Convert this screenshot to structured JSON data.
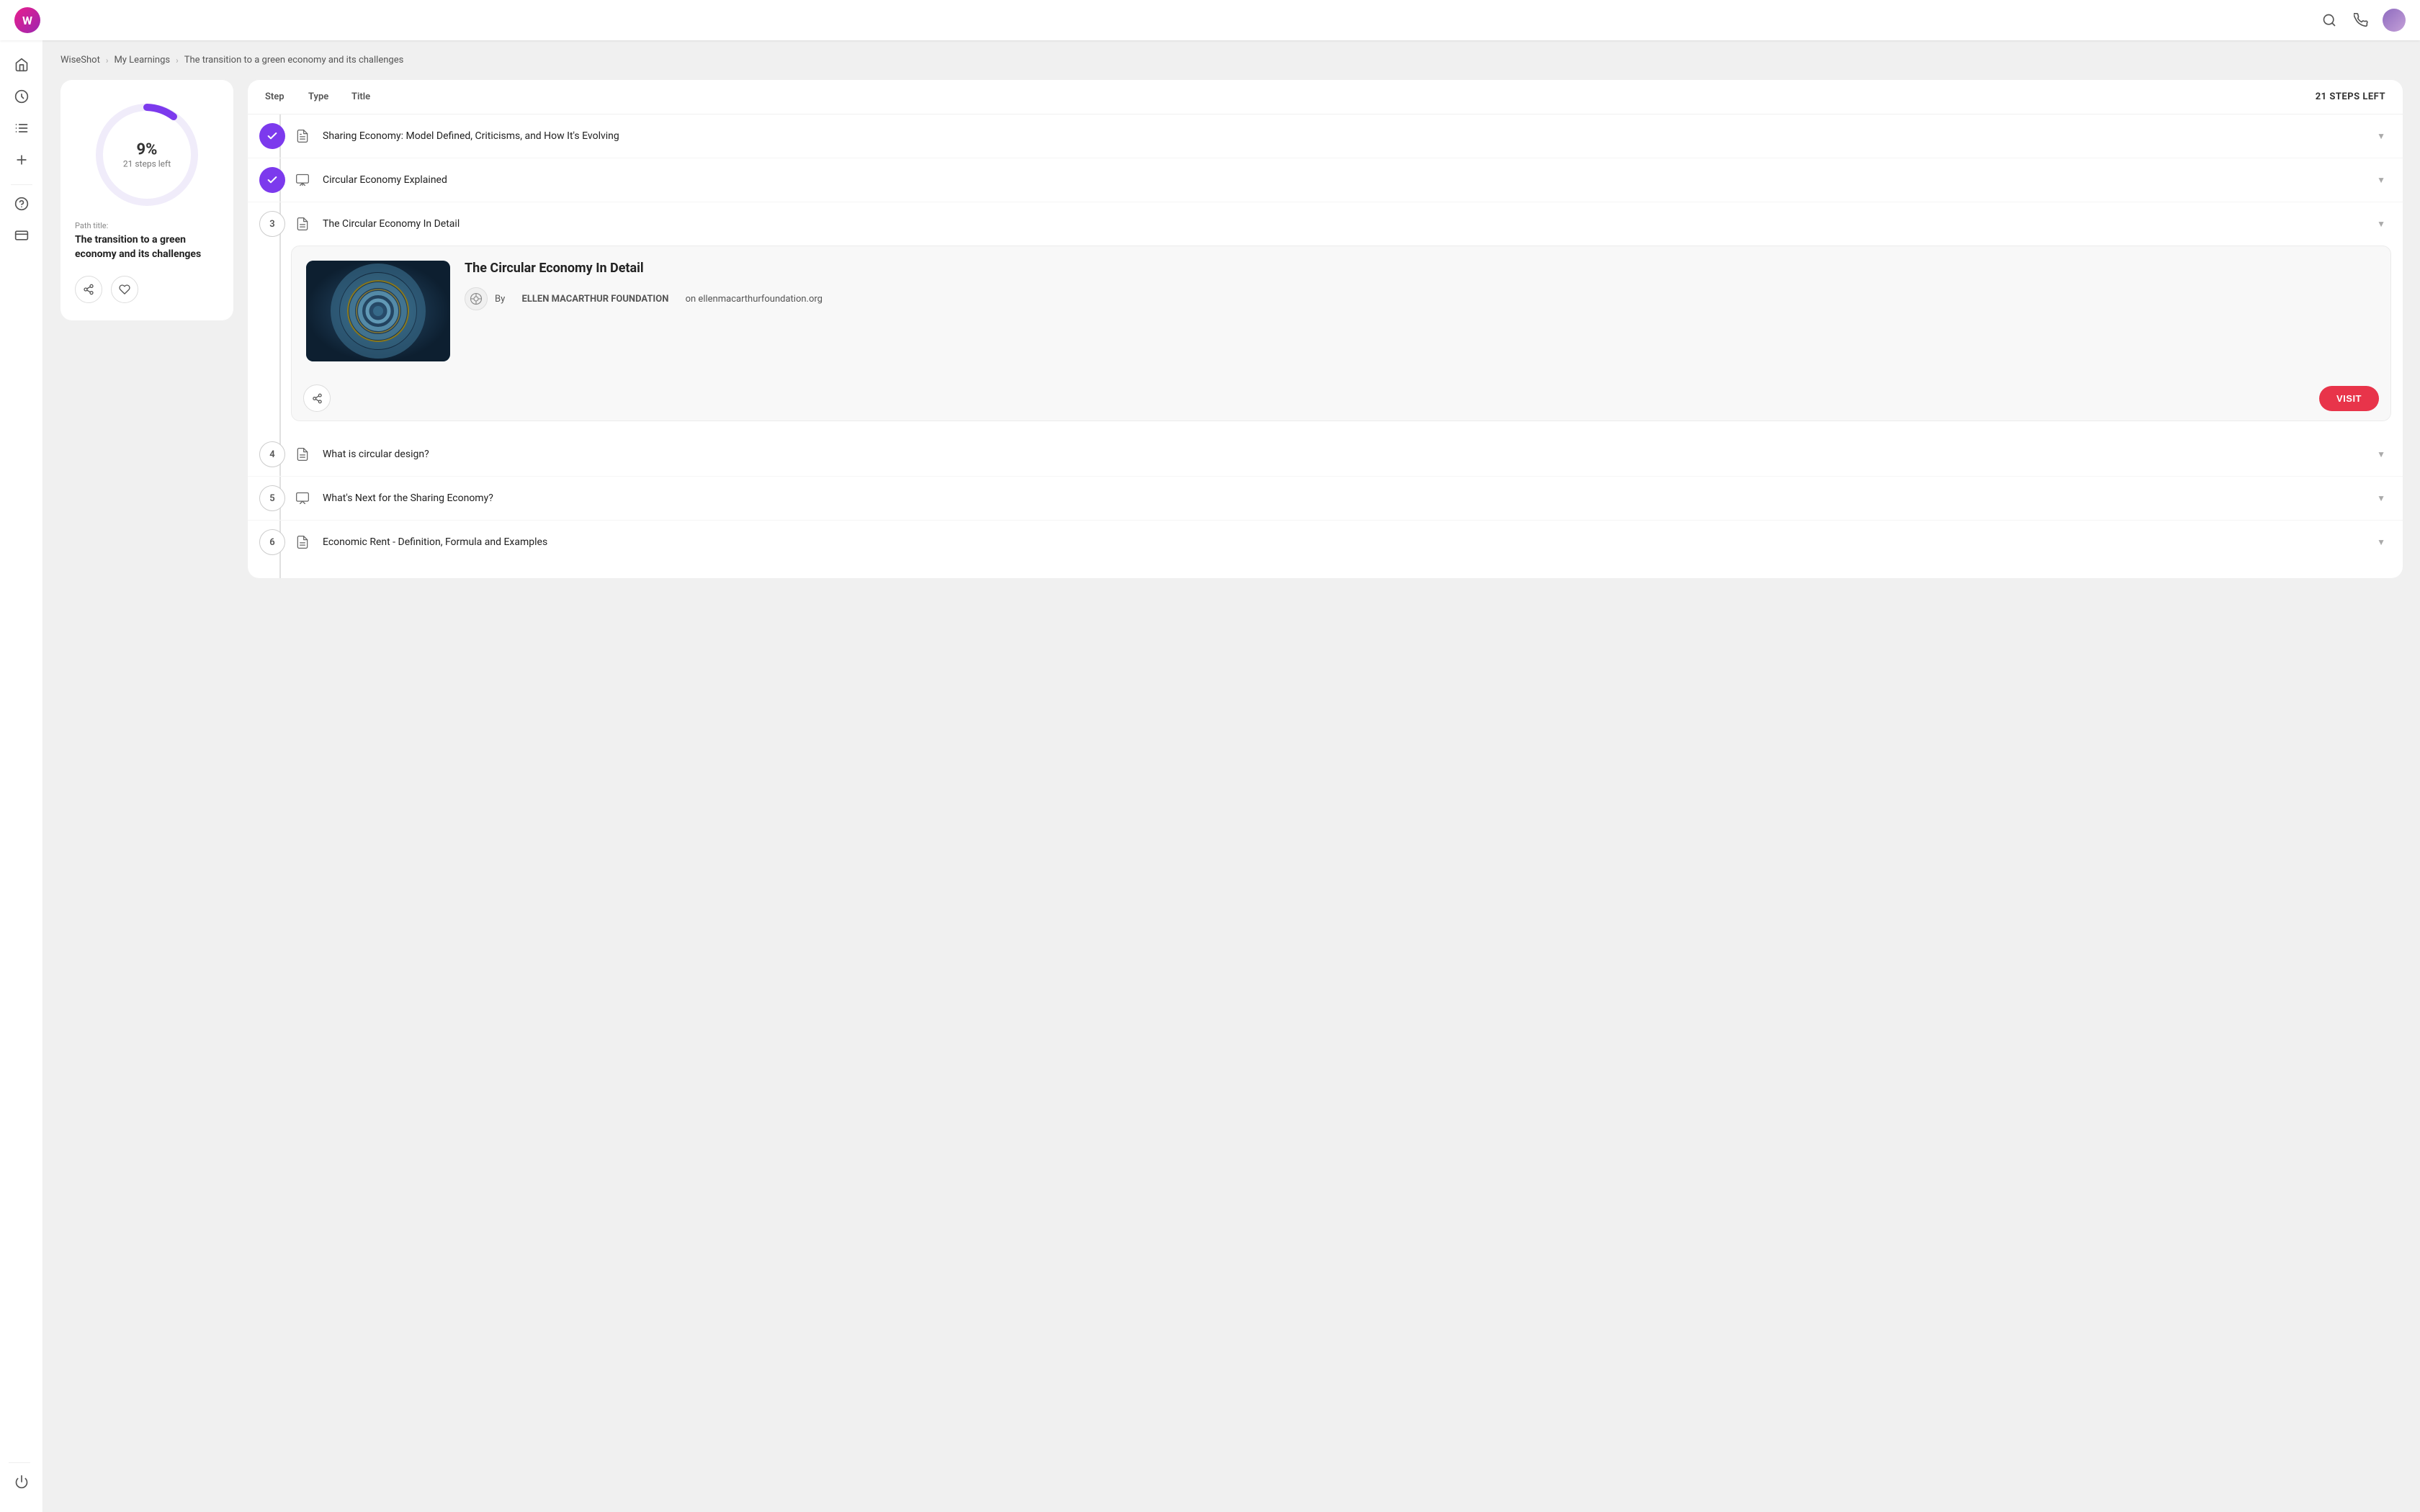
{
  "app": {
    "logo_text": "W",
    "title": "WiseShot"
  },
  "breadcrumb": {
    "items": [
      "WiseShot",
      "My Learnings",
      "The transition to a green economy and its challenges"
    ]
  },
  "sidebar": {
    "icons": [
      {
        "name": "home-icon",
        "symbol": "⌂"
      },
      {
        "name": "lightbulb-icon",
        "symbol": "💡"
      },
      {
        "name": "list-icon",
        "symbol": "☰"
      },
      {
        "name": "add-icon",
        "symbol": "+"
      },
      {
        "name": "help-icon",
        "symbol": "?"
      },
      {
        "name": "card-icon",
        "symbol": "▭"
      },
      {
        "name": "power-icon",
        "symbol": "⏻"
      }
    ]
  },
  "progress": {
    "percent": "9%",
    "steps_left_label": "21 steps left",
    "arc_color": "#7c3aed",
    "track_color": "#e8e0f5"
  },
  "path": {
    "label": "Path title:",
    "title": "The transition to a green economy and its challenges"
  },
  "steps_header": {
    "step_col": "Step",
    "type_col": "Type",
    "title_col": "Title",
    "count": "21 STEPS LEFT"
  },
  "steps": [
    {
      "number": 1,
      "completed": true,
      "type": "article",
      "title": "Sharing Economy: Model Defined, Criticisms, and How It's Evolving",
      "expanded": false
    },
    {
      "number": 2,
      "completed": true,
      "type": "video",
      "title": "Circular Economy Explained",
      "expanded": false
    },
    {
      "number": 3,
      "completed": false,
      "type": "article",
      "title": "The Circular Economy In Detail",
      "expanded": true,
      "article": {
        "title": "The Circular Economy In Detail",
        "source_text": "By",
        "source_name": "ELLEN MACARTHUR FOUNDATION",
        "source_url_text": "on ellenmacarthurfoundation.org"
      }
    },
    {
      "number": 4,
      "completed": false,
      "type": "article",
      "title": "What is circular design?",
      "expanded": false
    },
    {
      "number": 5,
      "completed": false,
      "type": "video",
      "title": "What's Next for the Sharing Economy?",
      "expanded": false
    },
    {
      "number": 6,
      "completed": false,
      "type": "article",
      "title": "Economic Rent - Definition, Formula and Examples",
      "expanded": false
    }
  ],
  "buttons": {
    "share_label": "share",
    "like_label": "like",
    "visit_label": "VISIT"
  }
}
